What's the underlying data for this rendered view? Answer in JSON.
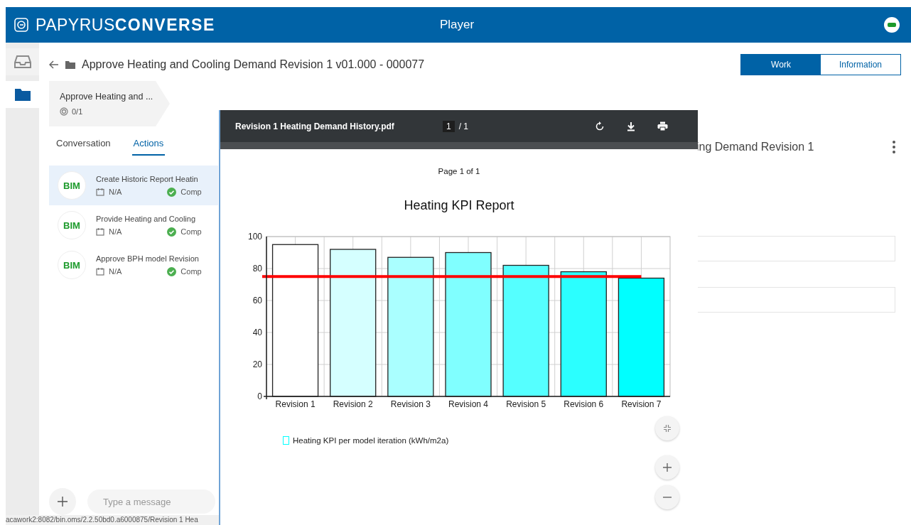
{
  "header": {
    "brand": "PAPYRUS**CONVERSE**",
    "title": "Player"
  },
  "rail": [
    {
      "kind": "inbox",
      "selected": false
    },
    {
      "kind": "folder",
      "selected": true
    }
  ],
  "title": "Approve Heating and Cooling Demand Revision 1 v01.000 - 000077",
  "view_toggle": [
    {
      "label": "Work",
      "selected": true
    },
    {
      "label": "Information",
      "selected": false
    }
  ],
  "breadcrumb": {
    "label": "Approve Heating and ...",
    "progress": "0/1"
  },
  "tabs": [
    {
      "label": "Conversation",
      "selected": false
    },
    {
      "label": "Actions",
      "selected": true
    }
  ],
  "actions": [
    {
      "avatar": "BIM",
      "title": "Create Historic Report Heatin",
      "due": "N/A",
      "status": "Comp",
      "selected": true
    },
    {
      "avatar": "BIM",
      "title": "Provide Heating and Cooling",
      "due": "N/A",
      "status": "Comp",
      "selected": false
    },
    {
      "avatar": "BIM",
      "title": "Approve BPH model Revision",
      "due": "N/A",
      "status": "Comp",
      "selected": false
    }
  ],
  "detail": {
    "title": "ing Demand Revision 1"
  },
  "composer": {
    "placeholder": "Type a message"
  },
  "pdf_viewer": {
    "file": "Revision 1 Heating Demand History.pdf",
    "page": "1",
    "page_total": "/ 1",
    "page_label": "Page 1 of 1",
    "chart_data": {
      "type": "bar",
      "title": "Heating KPI Report",
      "categories": [
        "Revision 1",
        "Revision 2",
        "Revision 3",
        "Revision 4",
        "Revision 5",
        "Revision 6",
        "Revision 7"
      ],
      "series": [
        {
          "name": "Heating KPI per model iteration (kWh/m2a)",
          "color": "#00ffff",
          "colors": [
            "#ffffff",
            "#d5ffff",
            "#aaffff",
            "#80ffff",
            "#55ffff",
            "#2bffff",
            "#00ffff"
          ],
          "values": [
            95,
            92,
            87,
            90,
            82,
            78,
            74
          ]
        }
      ],
      "ylim": [
        0,
        100
      ],
      "yticks": [
        0,
        20,
        40,
        60,
        80,
        100
      ],
      "grid": true,
      "ref_lines": [
        {
          "axis": "y",
          "value": 75,
          "color": "#ff0000"
        }
      ]
    }
  },
  "status_url": "acawork2:8082/bin.oms/2.2.50bd0.a6000875/Revision 1 Hea"
}
